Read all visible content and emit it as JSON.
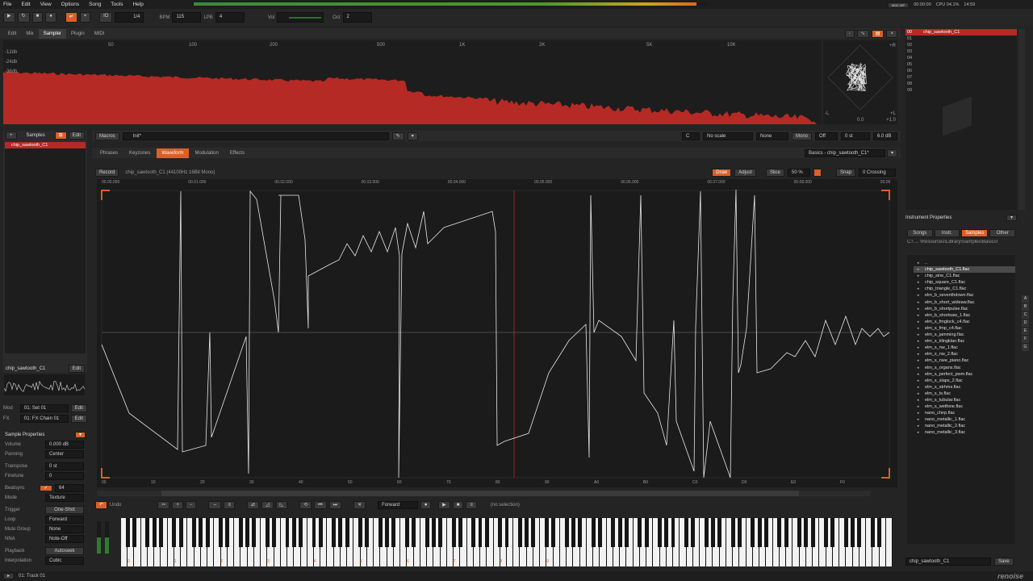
{
  "menu": {
    "file": "File",
    "edit": "Edit",
    "view": "View",
    "options": "Options",
    "song": "Song",
    "tools": "Tools",
    "help": "Help"
  },
  "transport": {
    "lines_per_beat": "1/4",
    "bpm_label": "BPM",
    "bpm": "115",
    "lpb_label": "LPB",
    "lpb": "4",
    "vol_label": "Vol",
    "oct_label": "Oct",
    "oct": "2",
    "time": "00:00:00",
    "cpu": "CPU 04.1%",
    "clock": "14:59",
    "midi_badge": "MIDI INP"
  },
  "upper_tabs": [
    "Edit",
    "Mix",
    "Sampler",
    "Plugin",
    "MIDI"
  ],
  "upper_active": "Sampler",
  "spectrum": {
    "db_labels": [
      "-12db",
      "-24db",
      "-36db"
    ],
    "freq_labels": [
      "50",
      "100",
      "200",
      "500",
      "1K",
      "2K",
      "5K",
      "10K"
    ],
    "scope_labels": [
      "+R",
      "-L",
      "-R",
      "+L"
    ],
    "scope_readouts": [
      "0.0",
      "+1.0"
    ],
    "bar_color": "#b52a25"
  },
  "track_list": [
    "00",
    "01",
    "02",
    "03",
    "04",
    "05",
    "06",
    "07",
    "08",
    "09"
  ],
  "instrument_name": "chip_sawtooth_C1",
  "left": {
    "samples_title": "Samples",
    "edit_label": "Edit",
    "sample_item": "chip_sawtooth_C1",
    "thumb_name": "chip_sawtooth_C1",
    "mod_label": "Mod",
    "mod_value": "01: Set 01",
    "fx_label": "FX",
    "fx_value": "01: FX Chain 01",
    "props_title": "Sample Properties",
    "props": [
      {
        "label": "Volume",
        "value": "0.000 dB"
      },
      {
        "label": "Panning",
        "value": "Center"
      },
      {
        "label": "Transpose",
        "value": "0 st"
      },
      {
        "label": "Finetune",
        "value": "0"
      },
      {
        "label": "Beatsync",
        "value": "64"
      },
      {
        "label": "Mode",
        "value": "Texture"
      },
      {
        "label": "Trigger",
        "value": "One-Shot"
      },
      {
        "label": "Loop",
        "value": "Forward"
      },
      {
        "label": "Mute Group",
        "value": "None"
      },
      {
        "label": "NNA",
        "value": "Note-Off"
      },
      {
        "label": "Playback",
        "value": "Autoseek"
      },
      {
        "label": "Interpolation",
        "value": "Cubic"
      }
    ]
  },
  "macros": {
    "label": "Macros",
    "value": "Init*",
    "scale": "No scale",
    "key": "None",
    "mono": "Mono",
    "off": "Off",
    "st": "0 st",
    "db": "6.0 dB"
  },
  "editor_tabs": [
    "Phrases",
    "Keyzones",
    "Waveform",
    "Modulation",
    "Effects"
  ],
  "editor_active": "Waveform",
  "instrument_preset": "Basics - chip_sawtooth_C1*",
  "waveform": {
    "record": "Record",
    "info": "chip_sawtooth_C1 (44100Hz 16Bit Mono)",
    "draw": "Draw",
    "adjust": "Adjust",
    "slice": "Slice",
    "zoom": "50 %",
    "snap": "Snap",
    "crossing": "0 Crossing",
    "time_labels": [
      "00.00.000",
      "00.01.000",
      "00.02.000",
      "00.03.000",
      "00.04.000",
      "00.05.000",
      "00.06.000",
      "00.07.000",
      "00.08.000",
      "00.09"
    ],
    "hex_labels": [
      "00",
      "10",
      "20",
      "30",
      "40",
      "50",
      "60",
      "70",
      "80",
      "90",
      "A0",
      "B0",
      "C0",
      "D0",
      "E0",
      "F0"
    ],
    "wave_color": "#e8e8e8",
    "marker_color": "#d9602a"
  },
  "bottom_toolbar": {
    "undo": "Undo",
    "direction": "Forward",
    "selection": "(no selection)"
  },
  "keyboard": {
    "octaves": [
      "0",
      "1",
      "2",
      "3",
      "4",
      "5",
      "6",
      "7",
      "8",
      "9"
    ]
  },
  "right": {
    "props_title": "Instrument Properties",
    "tabs": [
      "Songs",
      "Instr.",
      "Samples",
      "Other"
    ],
    "active_tab": "Samples",
    "path": "C:\\ ... \\Resources\\Library\\Samples\\Basics\\",
    "files": [
      "chip_sawtooth_C1.flac",
      "chip_sine_C1.flac",
      "chip_square_C1.flac",
      "chip_triangle_C1.flac",
      "elm_b_seventhdown.flac",
      "elm_b_short_wideaw.flac",
      "elm_b_shortpulse.flac",
      "elm_b_shortsaw_1.flac",
      "elm_s_fmglock_c4.flac",
      "elm_s_fmp_c4.flac",
      "elm_s_jamming.flac",
      "elm_s_klingklan.flac",
      "elm_s_nw_1.flac",
      "elm_s_nw_2.flac",
      "elm_s_nwe_piano.flac",
      "elm_s_organs.flac",
      "elm_s_perfect_pwm.flac",
      "elm_s_slaps_2.flac",
      "elm_s_strhms.flac",
      "elm_s_ts.flac",
      "elm_s_tubular.flac",
      "elm_s_wetfone.flac",
      "nano_chirp.flac",
      "nano_metallic_1.flac",
      "nano_metallic_2.flac",
      "nano_metallic_3.flac"
    ],
    "side_letters": [
      "A",
      "B",
      "C",
      "D",
      "E",
      "F",
      "G"
    ],
    "save_name": "chip_sawtooth_C1",
    "save": "Save"
  },
  "status": {
    "track": "01: Track 01",
    "brand": "renoise"
  }
}
